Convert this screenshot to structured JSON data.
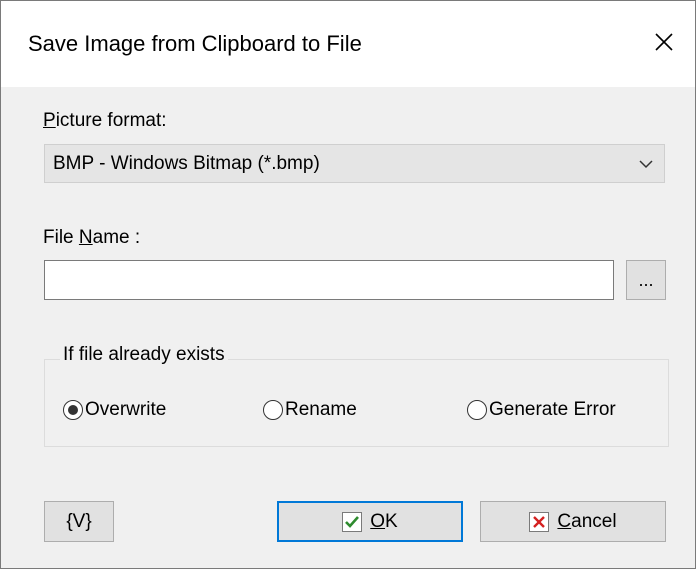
{
  "dialog": {
    "title": "Save Image from Clipboard to File",
    "close_icon": "close-icon"
  },
  "picture_format": {
    "label_accel": "P",
    "label_rest": "icture format:",
    "selected": "BMP - Windows Bitmap (*.bmp)"
  },
  "file_name": {
    "label_pre": "File ",
    "label_accel": "N",
    "label_rest": "ame :",
    "value": "",
    "browse_label": "..."
  },
  "exists_group": {
    "title": "If file already exists",
    "options": [
      {
        "label": "Overwrite",
        "checked": true
      },
      {
        "label": "Rename",
        "checked": false
      },
      {
        "label": "Generate Error",
        "checked": false
      }
    ]
  },
  "buttons": {
    "variables_label": "{V}",
    "ok_accel": "O",
    "ok_rest": "K",
    "cancel_accel": "C",
    "cancel_rest": "ancel"
  },
  "colors": {
    "ok_check": "#2e8b2e",
    "cancel_x": "#d42020",
    "default_border": "#0078d7"
  }
}
